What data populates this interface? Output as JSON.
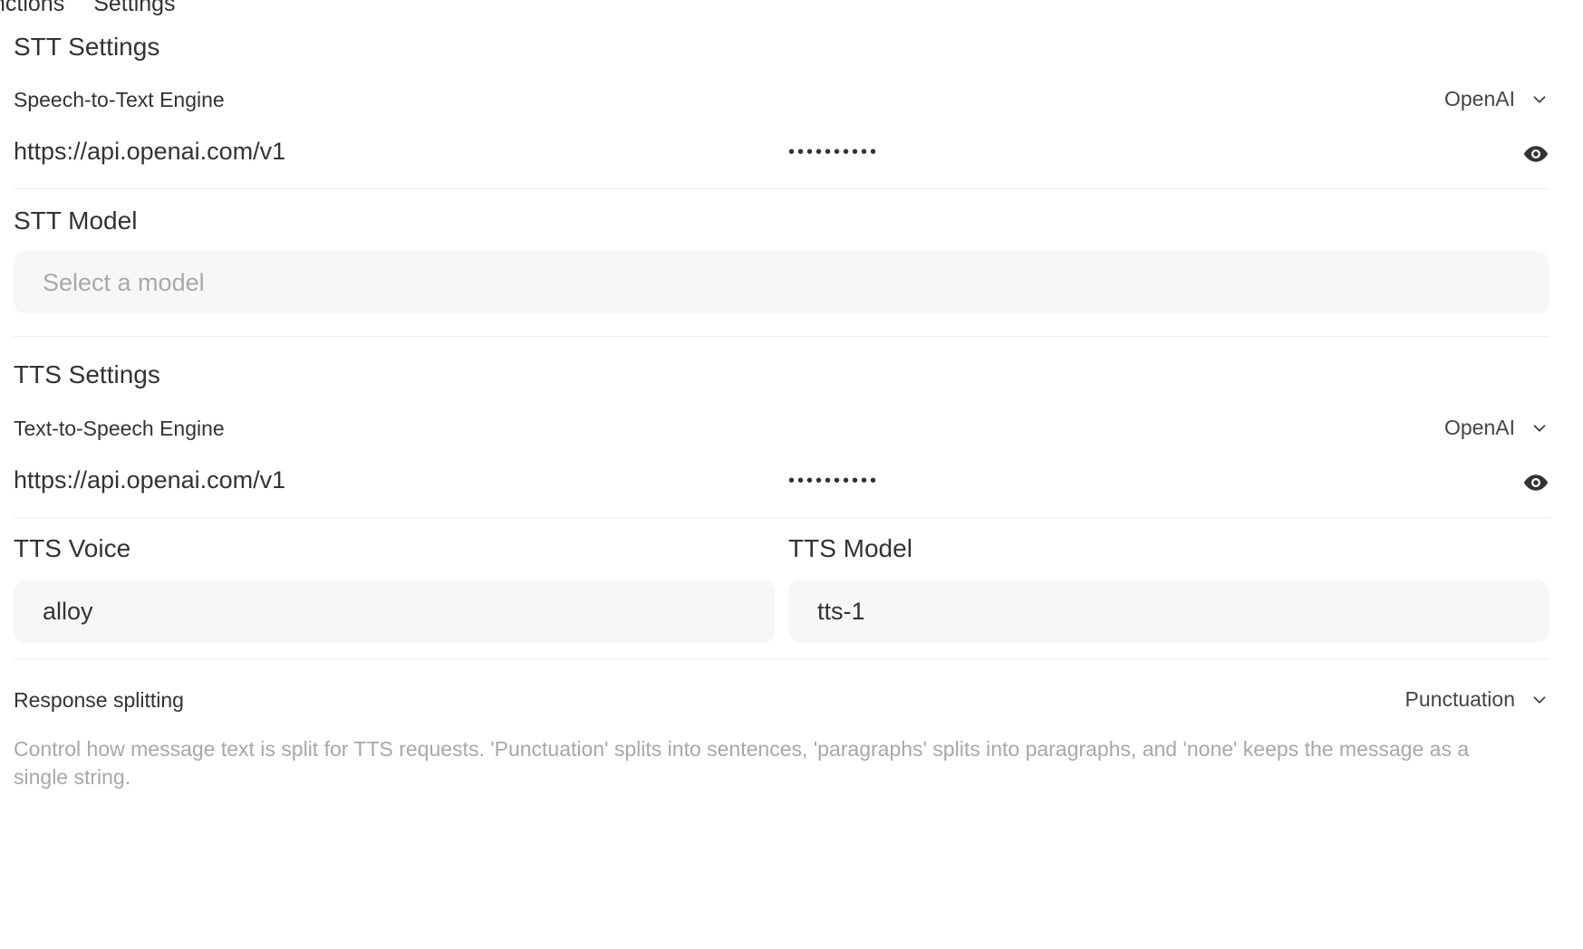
{
  "top_tabs": [
    "nctions",
    "Settings"
  ],
  "stt": {
    "section_title": "STT Settings",
    "engine_label": "Speech-to-Text Engine",
    "engine_value": "OpenAI",
    "api_url": "https://api.openai.com/v1",
    "api_key_mask": "••••••••••",
    "model_label": "STT Model",
    "model_placeholder": "Select a model"
  },
  "tts": {
    "section_title": "TTS Settings",
    "engine_label": "Text-to-Speech Engine",
    "engine_value": "OpenAI",
    "api_url": "https://api.openai.com/v1",
    "api_key_mask": "••••••••••",
    "voice_label": "TTS Voice",
    "voice_value": "alloy",
    "model_label": "TTS Model",
    "model_value": "tts-1"
  },
  "response_splitting": {
    "label": "Response splitting",
    "value": "Punctuation",
    "help": "Control how message text is split for TTS requests. 'Punctuation' splits into sentences, 'paragraphs' splits into paragraphs, and 'none' keeps the message as a single string."
  },
  "icons": {
    "chevron": "chevron-down-icon",
    "eye": "eye-icon"
  }
}
